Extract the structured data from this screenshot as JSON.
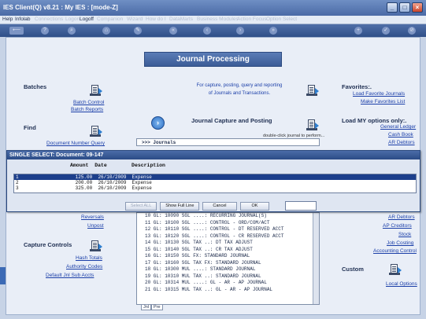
{
  "window": {
    "title": "IES Client(Q) v8.21 : My IES :      [mode-Z]"
  },
  "menu": {
    "items": [
      {
        "label": "Help",
        "dim": false
      },
      {
        "label": "Infolab",
        "dim": false
      },
      {
        "label": "Connections",
        "dim": true
      },
      {
        "label": "Logon",
        "dim": true
      },
      {
        "label": "Logoff",
        "dim": false
      },
      {
        "label": "Companion",
        "dim": true
      },
      {
        "label": "Wizard",
        "dim": true
      },
      {
        "label": "How do I",
        "dim": true
      },
      {
        "label": "DataMarts",
        "dim": true
      },
      {
        "label": "Business Modules",
        "dim": true
      },
      {
        "label": "Action Focus",
        "dim": true
      },
      {
        "label": "Option Select",
        "dim": true
      }
    ]
  },
  "banner": {
    "title": "Journal Processing"
  },
  "left": {
    "batches_heading": "Batches",
    "batch_control": "Batch Control",
    "batch_reports": "Batch Reports",
    "find_heading": "Find",
    "doc_query": "Document Number Query",
    "reversals": "Reversals",
    "unpost": "Unpost",
    "capture_heading": "Capture Controls",
    "hash_totals": "Hash Totals",
    "authority_codes": "Authority Codes",
    "default_sub_accts": "Default Jnl Sub Accts"
  },
  "center": {
    "intro_line1": "For capture, posting, query and reporting",
    "intro_line2": "of Journals and Transactions.",
    "capture_heading": "Journal Capture and Posting",
    "dblclick_hint": "double-click journal to perform...",
    "list_header": ">>> Journals",
    "journals": [
      "10  GL: 10090 SGL ....: RECURRING JOURNAL(S)",
      "11  GL: 10100 SGL ....: CONTROL - ORD/COM/ACT",
      "12  GL: 10110 SGL ....: CONTROL - DT RESERVED ACCT",
      "13  GL: 10120 SGL ....: CONTROL - CR RESERVED ACCT",
      "14  GL: 10130 SGL TAX ..: DT TAX ADJUST",
      "15  GL: 10140 SGL TAX ..: CR TAX ADJUST",
      "16  GL: 10150 SGL FX: STANDARD JOURNAL",
      "17  GL: 10160 SGL TAX FX: STANDARD JOURNAL",
      "18  GL: 10300 MUL ....: STANDARD JOURNAL",
      "19  GL: 10310 MUL TAX ..: STANDARD JOURNAL",
      "20  GL: 10314 MUL ....: GL - AR - AP JOURNAL",
      "21  GL: 10315 MUL TAX ..: GL - AR - AP JOURNAL"
    ],
    "tab1": "Jnl",
    "tab2": "Pre"
  },
  "right": {
    "favorites_heading": "Favorites:.",
    "load_favorites": "Load Favorite Journals",
    "make_favorites": "Make Favorites List",
    "options_heading": "Load MY options only:.",
    "general_ledger": "General Ledger",
    "cash_book": "Cash Book",
    "ar_debtors": "AR Debtors",
    "ar_debtors2": "AR Debtors",
    "ap_creditors": "AP Creditors",
    "stock": "Stock",
    "job_costing": "Job Costing",
    "accounting_control": "Accounting Control",
    "custom_heading": "Custom",
    "local_options": "Local Options"
  },
  "dialog": {
    "title": "SINGLE SELECT: Document: 09-147",
    "col_amount": "Amount",
    "col_date": "Date",
    "col_description": "Description",
    "rows": [
      {
        "id": "1",
        "amount": "125.00",
        "date": "26/10/2009",
        "description": "Expense",
        "selected": true
      },
      {
        "id": "2",
        "amount": "200.00",
        "date": "26/10/2009",
        "description": "Expense",
        "selected": false
      },
      {
        "id": "3",
        "amount": "325.00",
        "date": "26/10/2009",
        "description": "Expense",
        "selected": false
      }
    ],
    "btn_select_all": "Select ALL",
    "btn_show_full": "Show Full Line",
    "btn_cancel": "Cancel",
    "btn_ok": "OK",
    "input_value": ""
  },
  "colors": {
    "accent": "#2b4b86",
    "link": "#1a3ea8",
    "selection": "#1c3f8c"
  },
  "icons": [
    "document-arrow-icon",
    "circle-arrow-icon",
    "minimize-icon",
    "maximize-icon",
    "close-icon"
  ]
}
